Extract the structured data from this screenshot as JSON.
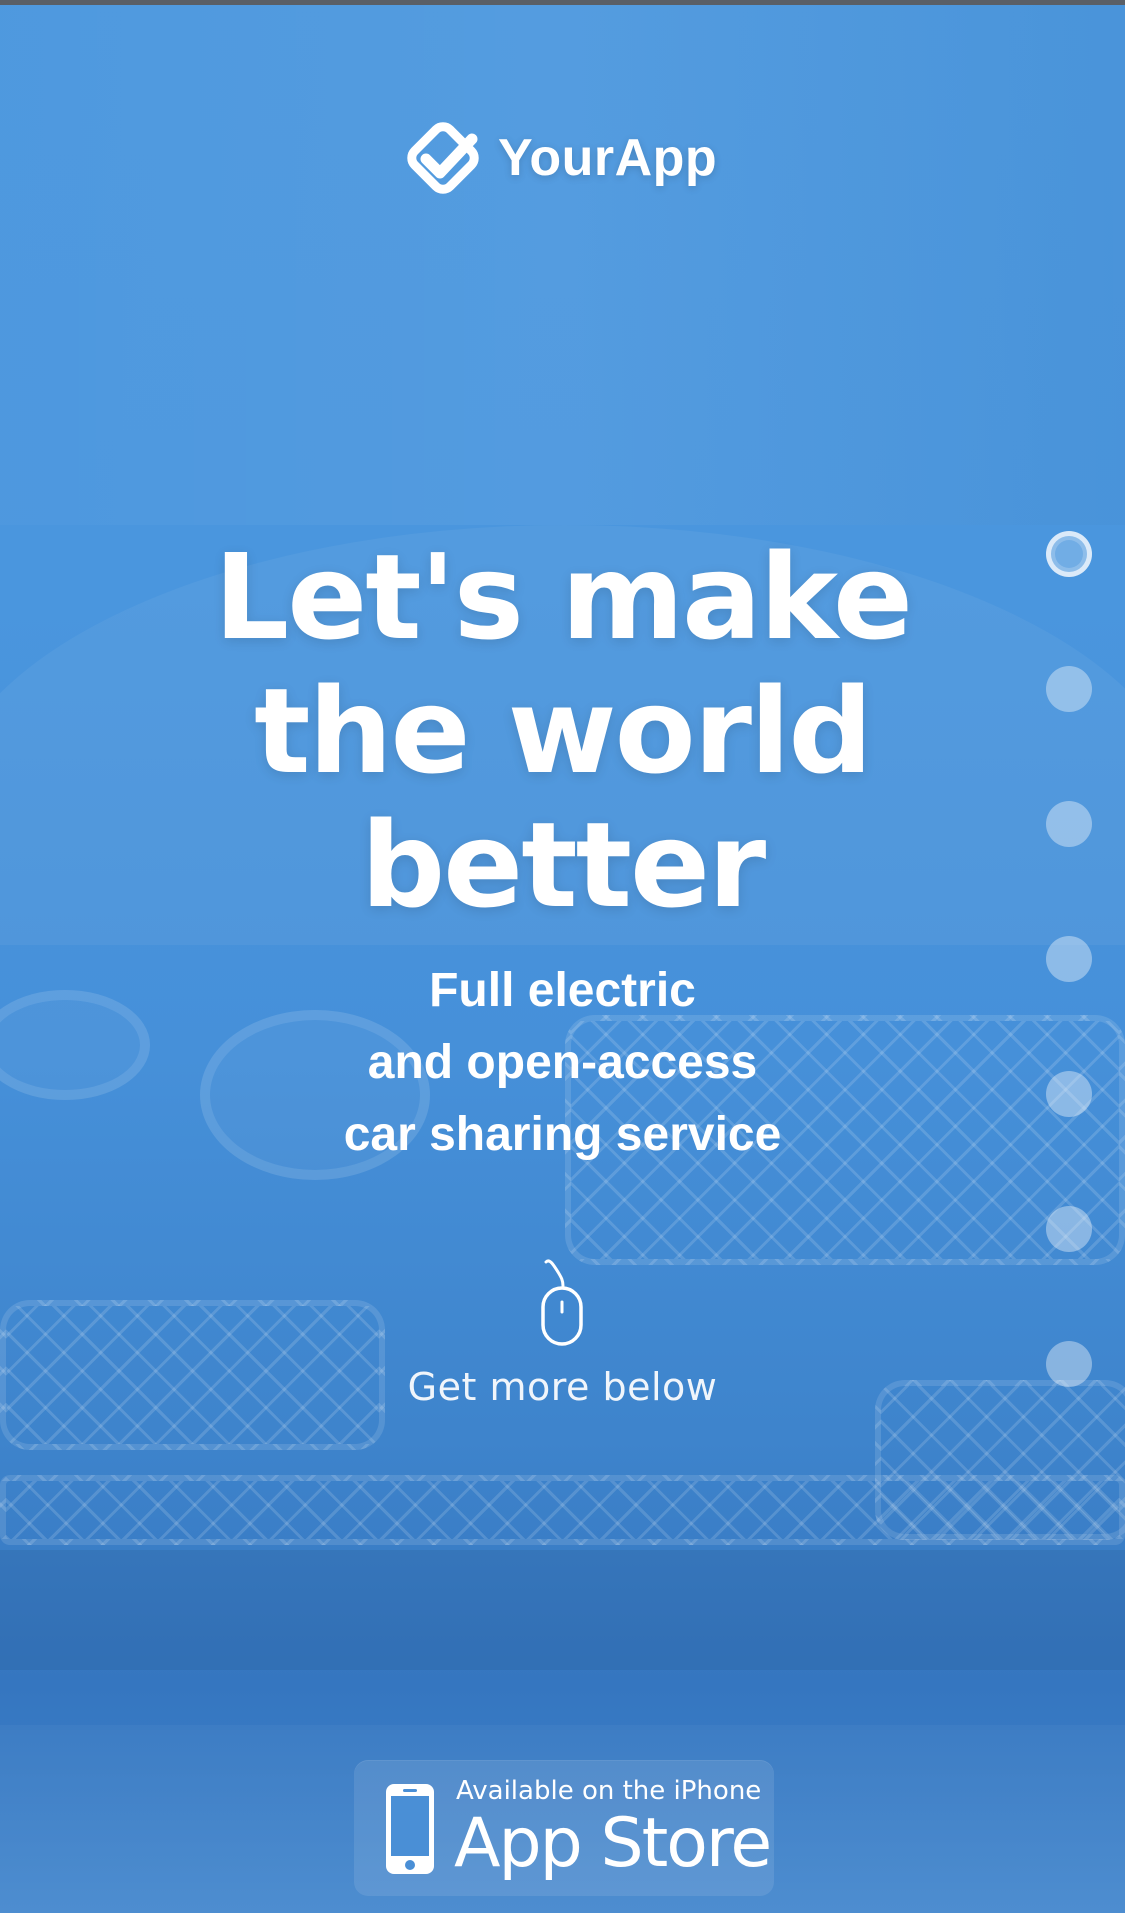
{
  "brand": {
    "name": "YourApp",
    "logo_icon": "check-badge-icon"
  },
  "hero": {
    "headline_lines": [
      "Let's make",
      "the world",
      "better"
    ],
    "subhead_lines": [
      "Full electric",
      "and open-access",
      "car sharing service"
    ],
    "scroll_hint": "Get more below",
    "scroll_icon": "mouse-icon"
  },
  "pagination": {
    "count": 7,
    "active_index": 0
  },
  "appstore_badge": {
    "small_text": "Available on the iPhone",
    "big_text": "App Store",
    "icon": "iphone-icon"
  },
  "colors": {
    "background": "#4a96de",
    "text": "#ffffff"
  }
}
